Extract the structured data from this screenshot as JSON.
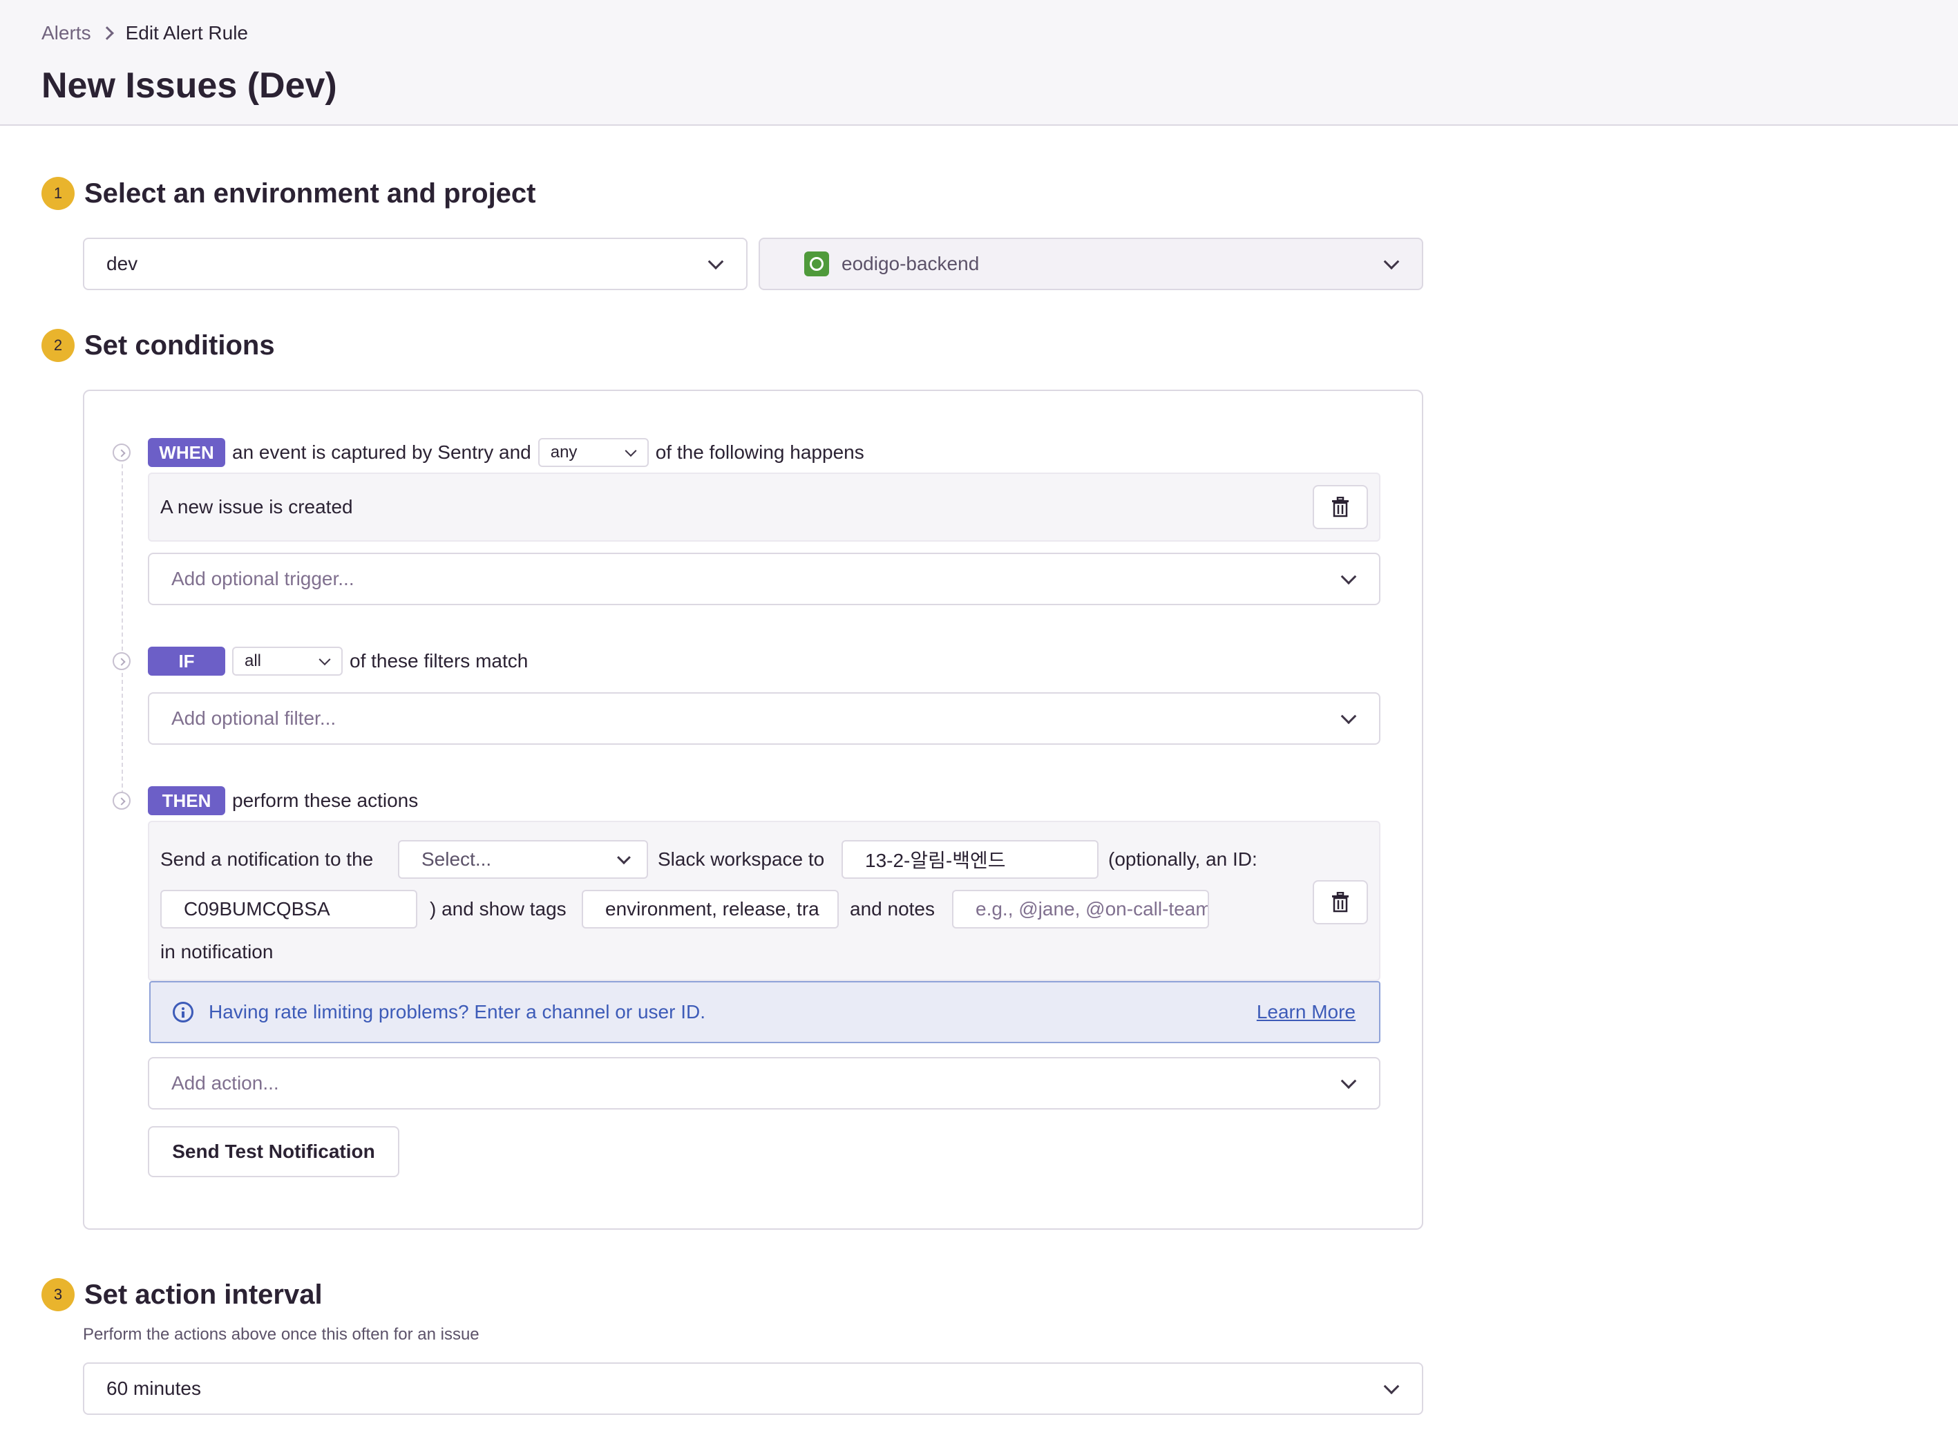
{
  "breadcrumb": {
    "parent": "Alerts",
    "current": "Edit Alert Rule"
  },
  "page_title": "New Issues (Dev)",
  "step1": {
    "number": "1",
    "title": "Select an environment and project",
    "environment": "dev",
    "project": "eodigo-backend"
  },
  "step2": {
    "number": "2",
    "title": "Set conditions",
    "when": {
      "tag": "WHEN",
      "text_before": "an event is captured by Sentry and",
      "match": "any",
      "text_after": "of the following happens",
      "trigger": "A new issue is created",
      "add_trigger_placeholder": "Add optional trigger..."
    },
    "if": {
      "tag": "IF",
      "match": "all",
      "text_after": "of these filters match",
      "add_filter_placeholder": "Add optional filter..."
    },
    "then": {
      "tag": "THEN",
      "text_after": "perform these actions",
      "action": {
        "send_prefix": "Send a notification to the",
        "workspace_placeholder": "Select...",
        "workspace_suffix": "Slack workspace to",
        "channel": "13-2-알림-백엔드",
        "optional_id_label": "(optionally, an ID:",
        "channel_id": "C09BUMCQBSA",
        "show_tags_label": ") and show tags",
        "tags": "environment, release, tra",
        "notes_label": "and notes",
        "notes_placeholder": "e.g., @jane, @on-call-team",
        "in_notification": "in notification"
      },
      "rate_limit_alert": "Having rate limiting problems? Enter a channel or user ID.",
      "learn_more": "Learn More",
      "add_action_placeholder": "Add action...",
      "test_button": "Send Test Notification"
    }
  },
  "step3": {
    "number": "3",
    "title": "Set action interval",
    "description": "Perform the actions above once this often for an issue",
    "interval": "60 minutes"
  }
}
